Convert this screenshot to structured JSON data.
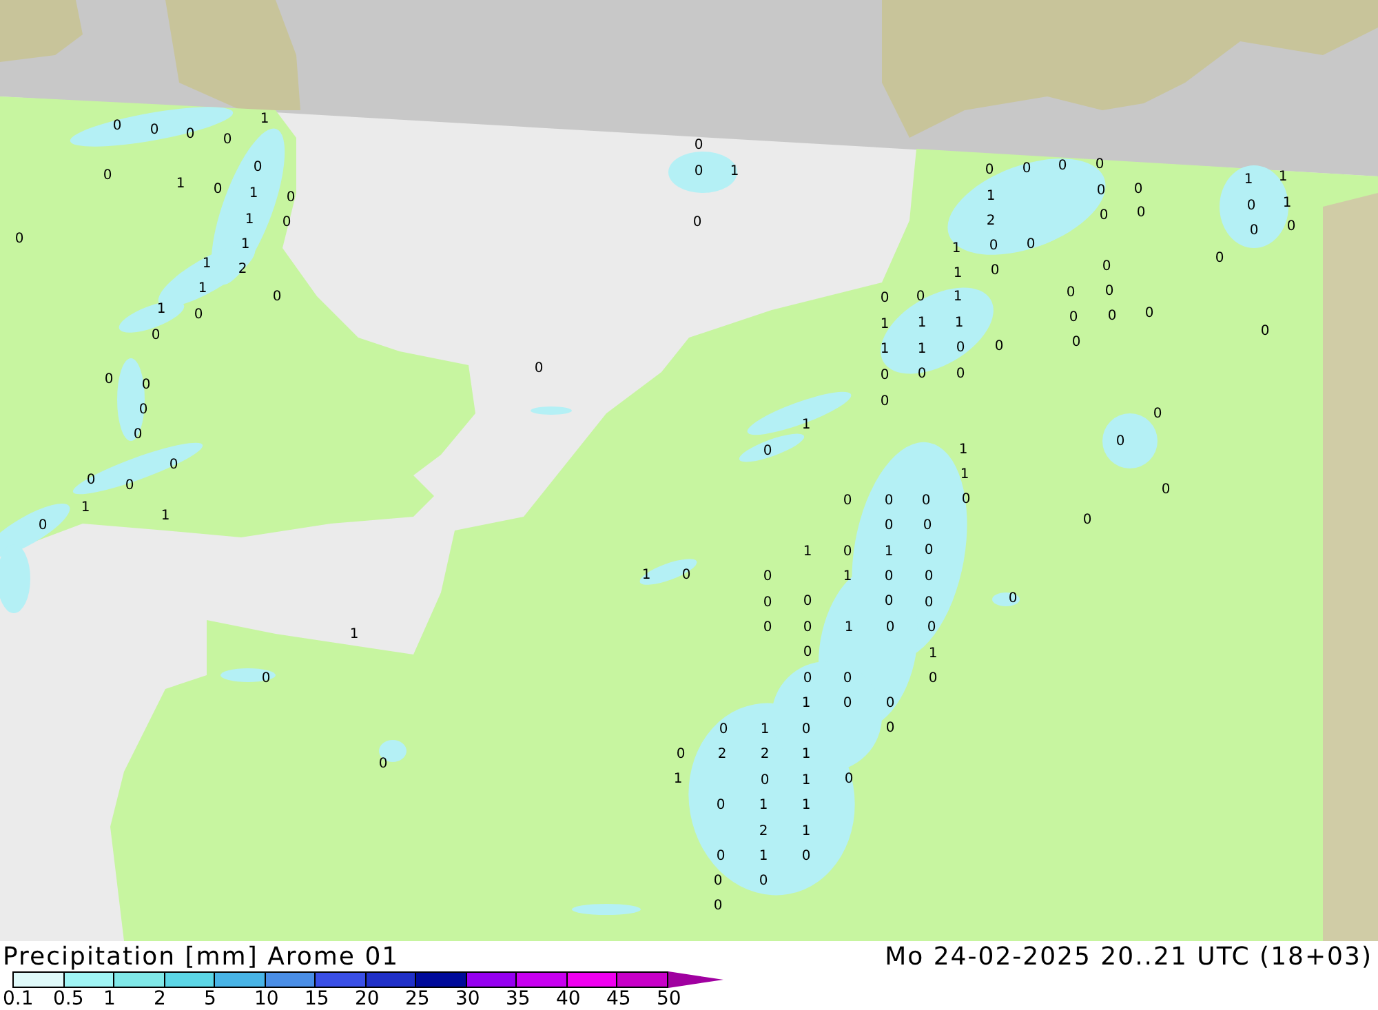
{
  "map": {
    "values": [
      "0",
      "0",
      "0",
      "0",
      "1",
      "0",
      "0",
      "1",
      "0",
      "1",
      "0",
      "1",
      "0",
      "0",
      "1",
      "1",
      "2",
      "1",
      "0",
      "1",
      "0",
      "0",
      "0",
      "0",
      "0",
      "0",
      "0",
      "0",
      "0",
      "1",
      "0",
      "1",
      "0",
      "0",
      "1",
      "0",
      "0",
      "0",
      "0",
      "0",
      "0",
      "1",
      "0",
      "0",
      "1",
      "1",
      "0",
      "0",
      "0",
      "1",
      "2",
      "0",
      "0",
      "1",
      "0",
      "0",
      "0",
      "1",
      "0",
      "0",
      "0",
      "0",
      "1",
      "0",
      "0",
      "1",
      "1",
      "1",
      "0",
      "0",
      "0",
      "0",
      "1",
      "1",
      "0",
      "0",
      "0",
      "0",
      "0",
      "0",
      "0",
      "1",
      "0",
      "0",
      "0",
      "1",
      "1",
      "0",
      "0",
      "0",
      "0",
      "0",
      "0",
      "0",
      "0",
      "1",
      "0",
      "1",
      "0",
      "1",
      "0",
      "0",
      "1",
      "0",
      "0",
      "0",
      "0",
      "0",
      "0",
      "0",
      "0",
      "0",
      "1",
      "0",
      "0",
      "1",
      "0",
      "1",
      "0",
      "0",
      "0",
      "0",
      "1",
      "0",
      "0",
      "0",
      "1",
      "0",
      "0",
      "0",
      "0",
      "2",
      "2",
      "1",
      "1",
      "0",
      "1",
      "0",
      "0",
      "1",
      "1",
      "2",
      "1",
      "0",
      "1",
      "0",
      "0",
      "0",
      "0"
    ]
  },
  "title": "Precipitation [mm] Arome 01",
  "valid_time": "Mo 24-02-2025 20..21 UTC (18+03)",
  "legend": {
    "boxes": [
      {
        "color": "#e0fafa"
      },
      {
        "color": "#a0f5f5"
      },
      {
        "color": "#80e8e8"
      },
      {
        "color": "#5cd6e6"
      },
      {
        "color": "#48b4e6"
      },
      {
        "color": "#4a8ee6"
      },
      {
        "color": "#3a4fe6"
      },
      {
        "color": "#2030c8"
      },
      {
        "color": "#000a9a"
      },
      {
        "color": "#9600f0"
      },
      {
        "color": "#c800f0"
      },
      {
        "color": "#f000f0"
      },
      {
        "color": "#c800c8"
      }
    ],
    "ticks": [
      "0.1",
      "0.5",
      "1",
      "2",
      "5",
      "10",
      "15",
      "20",
      "25",
      "30",
      "35",
      "40",
      "45",
      "50"
    ]
  }
}
